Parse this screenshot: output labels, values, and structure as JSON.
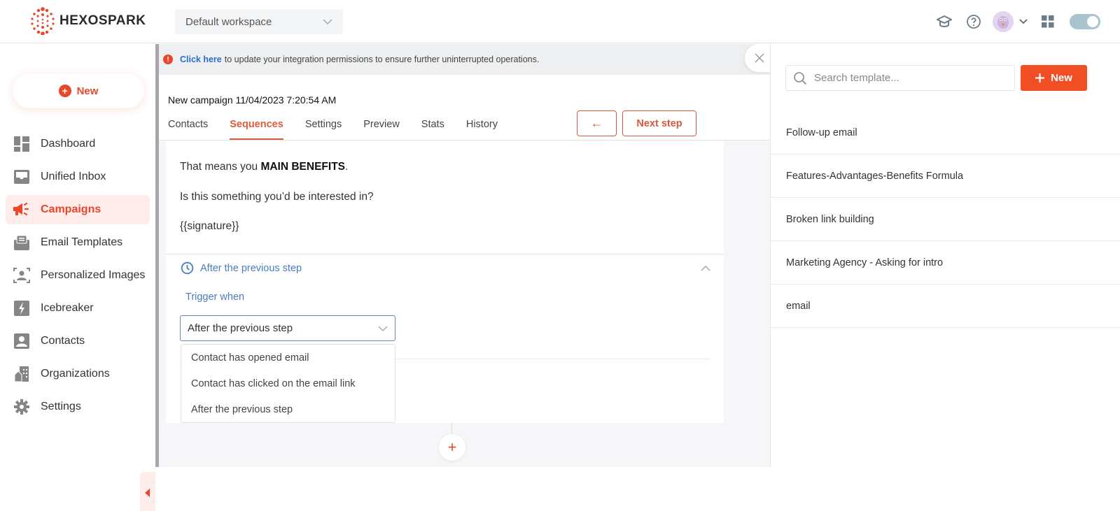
{
  "brand": {
    "name": "HEXOSPARK",
    "accent_color": "#e8472a"
  },
  "topbar": {
    "workspace_selector": "Default workspace",
    "icons": [
      "graduation-cap-icon",
      "help-icon",
      "avatar",
      "chevron-down-icon",
      "apps-grid-icon",
      "theme-toggle"
    ]
  },
  "sidebar": {
    "new_button": "New",
    "items": [
      {
        "label": "Dashboard",
        "icon": "dashboard-icon",
        "active": false
      },
      {
        "label": "Unified Inbox",
        "icon": "inbox-icon",
        "active": false
      },
      {
        "label": "Campaigns",
        "icon": "megaphone-icon",
        "active": true
      },
      {
        "label": "Email Templates",
        "icon": "email-template-icon",
        "active": false
      },
      {
        "label": "Personalized Images",
        "icon": "personalized-image-icon",
        "active": false
      },
      {
        "label": "Icebreaker",
        "icon": "lightning-icon",
        "active": false
      },
      {
        "label": "Contacts",
        "icon": "contact-icon",
        "active": false
      },
      {
        "label": "Organizations",
        "icon": "building-icon",
        "active": false
      },
      {
        "label": "Settings",
        "icon": "gear-icon",
        "active": false
      }
    ]
  },
  "alert": {
    "link_text": "Click here",
    "message": "to update your integration permissions to ensure further uninterrupted operations."
  },
  "campaign": {
    "title": "New campaign 11/04/2023 7:20:54 AM",
    "tabs": [
      {
        "label": "Contacts",
        "active": false
      },
      {
        "label": "Sequences",
        "active": true
      },
      {
        "label": "Settings",
        "active": false
      },
      {
        "label": "Preview",
        "active": false
      },
      {
        "label": "Stats",
        "active": false
      },
      {
        "label": "History",
        "active": false
      }
    ],
    "back_button": "←",
    "next_button": "Next step"
  },
  "email": {
    "line1_prefix": "That means you ",
    "line1_bold": "MAIN BENEFITS",
    "line1_suffix": ".",
    "line2": "Is this something you’d be interested in?",
    "line3": "{{signature}}"
  },
  "step": {
    "header": "After the previous step",
    "trigger_label": "Trigger when",
    "selected_trigger": "After the previous step",
    "trigger_options": [
      "Contact has opened email",
      "Contact has clicked on the email link",
      "After the previous step"
    ],
    "add_step": "+"
  },
  "templates": {
    "search_placeholder": "Search template...",
    "new_button": "New",
    "items": [
      "Follow-up email",
      "Features-Advantages-Benefits Formula",
      "Broken link building",
      "Marketing Agency - Asking for intro",
      "email"
    ]
  }
}
